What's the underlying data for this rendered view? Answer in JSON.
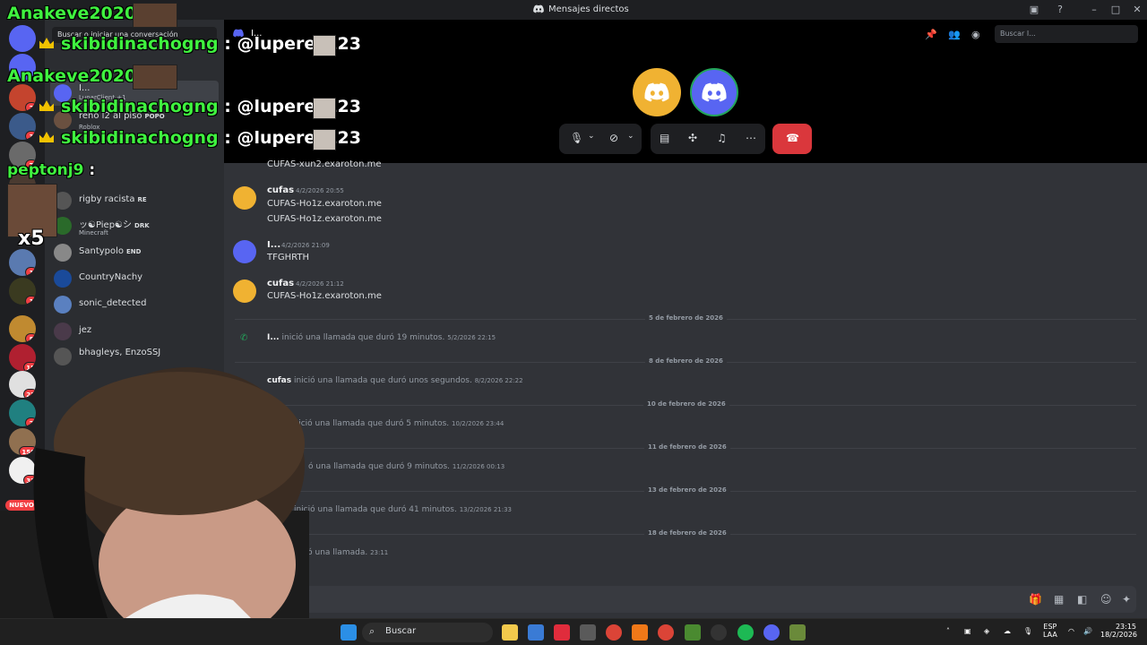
{
  "window": {
    "title": "Mensajes directos"
  },
  "dm_sidebar": {
    "search_placeholder": "Buscar o iniciar una conversación",
    "items": [
      {
        "name": "I...",
        "sub": "",
        "tag": ""
      },
      {
        "name": "LunarClient +1",
        "sub": "",
        "tag": ""
      },
      {
        "name": "reño l2 al piso",
        "sub": "Roblox",
        "tag": "POPO"
      },
      {
        "name": "rigby racista",
        "sub": "",
        "tag": "RE"
      },
      {
        "name": "ッ☯Piep☯シ",
        "sub": "Minecraft",
        "tag": "DRK"
      },
      {
        "name": "Santypolo",
        "sub": "",
        "tag": "END"
      },
      {
        "name": "CountryNachy",
        "sub": "",
        "tag": ""
      },
      {
        "name": "sonic_detected",
        "sub": "",
        "tag": ""
      },
      {
        "name": "jez",
        "sub": "",
        "tag": ""
      },
      {
        "name": "bhagleys, EnzoSSJ",
        "sub": "",
        "tag": ""
      }
    ]
  },
  "rail": {
    "badges": [
      "2",
      "3",
      "7",
      "2",
      "1",
      "1",
      "8",
      "15",
      "22",
      "2",
      "150",
      "32"
    ],
    "new_label": "NUEVO"
  },
  "call_header": {
    "channel_name": "I...",
    "search_placeholder": "Buscar I..."
  },
  "chat": {
    "messages": [
      {
        "author": "",
        "time": "",
        "lines": [
          "CUFAS-xun2.exaroton.me"
        ]
      },
      {
        "author": "cufas",
        "time": "4/2/2026 20:55",
        "lines": [
          "CUFAS-Ho1z.exaroton.me",
          "CUFAS-Ho1z.exaroton.me"
        ]
      },
      {
        "author": "I...",
        "time": "4/2/2026 21:09",
        "lines": [
          "TFGHRTH"
        ]
      },
      {
        "author": "cufas",
        "time": "4/2/2026 21:12",
        "lines": [
          "CUFAS-Ho1z.exaroton.me"
        ]
      }
    ],
    "dividers": [
      "5 de febrero de 2026",
      "8 de febrero de 2026",
      "10 de febrero de 2026",
      "11 de febrero de 2026",
      "13 de febrero de 2026",
      "18 de febrero de 2026"
    ],
    "calls": [
      {
        "who": "I...",
        "text": "inició una llamada que duró 19 minutos.",
        "time": "5/2/2026 22:15"
      },
      {
        "who": "cufas",
        "text": "inició una llamada que duró unos segundos.",
        "time": "8/2/2026 22:22"
      },
      {
        "who": "",
        "text": "inició una llamada que duró 5 minutos.",
        "time": "10/2/2026 23:44"
      },
      {
        "who": "",
        "text": "ó una llamada que duró 9 minutos.",
        "time": "11/2/2026 00:13"
      },
      {
        "who": "cufas",
        "text": "inició una llamada que duró 41 minutos.",
        "time": "13/2/2026 21:33"
      },
      {
        "who": "",
        "text": "inició una llamada.",
        "time": "23:11"
      }
    ]
  },
  "overlay": {
    "line1_user": "Anakeve2020",
    "line2_user": "skibidinachogng",
    "line2_mention": "@luperez123",
    "line3_user": "Anakeve2020",
    "line4_user": "skibidinachogng",
    "line4_mention": "@luperez123",
    "line5_user": "skibidinachogng",
    "line5_mention": "@luperez123",
    "line6_user": "peptonj9",
    "colon": ":",
    "multiplier": "x5"
  },
  "taskbar": {
    "search_label": "Buscar",
    "lang": "ESP",
    "lang2": "LAA",
    "time": "23:15",
    "date": "18/2/2026"
  },
  "colors": {
    "discord_blurple": "#5865f2",
    "discord_yellow": "#f0b232",
    "hangup_red": "#da373c",
    "online_green": "#23a55a"
  }
}
